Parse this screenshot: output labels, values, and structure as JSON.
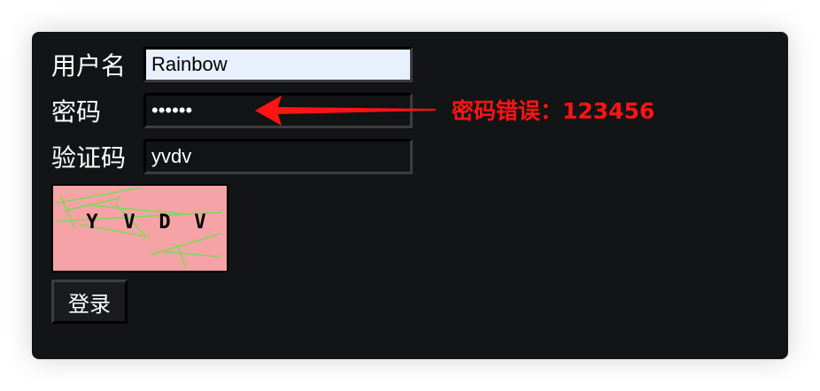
{
  "form": {
    "username": {
      "label": "用户名",
      "value": "Rainbow"
    },
    "password": {
      "label": "密码",
      "value": "••••••"
    },
    "captcha_input": {
      "label": "验证码",
      "value": "yvdv"
    },
    "captcha_image": {
      "text": "YVDV",
      "background": "#f5a3a6",
      "line_color": "#7ed957"
    },
    "login_button": {
      "label": "登录"
    }
  },
  "annotation": {
    "text": "密码错误：123456",
    "color": "#ff1414"
  }
}
